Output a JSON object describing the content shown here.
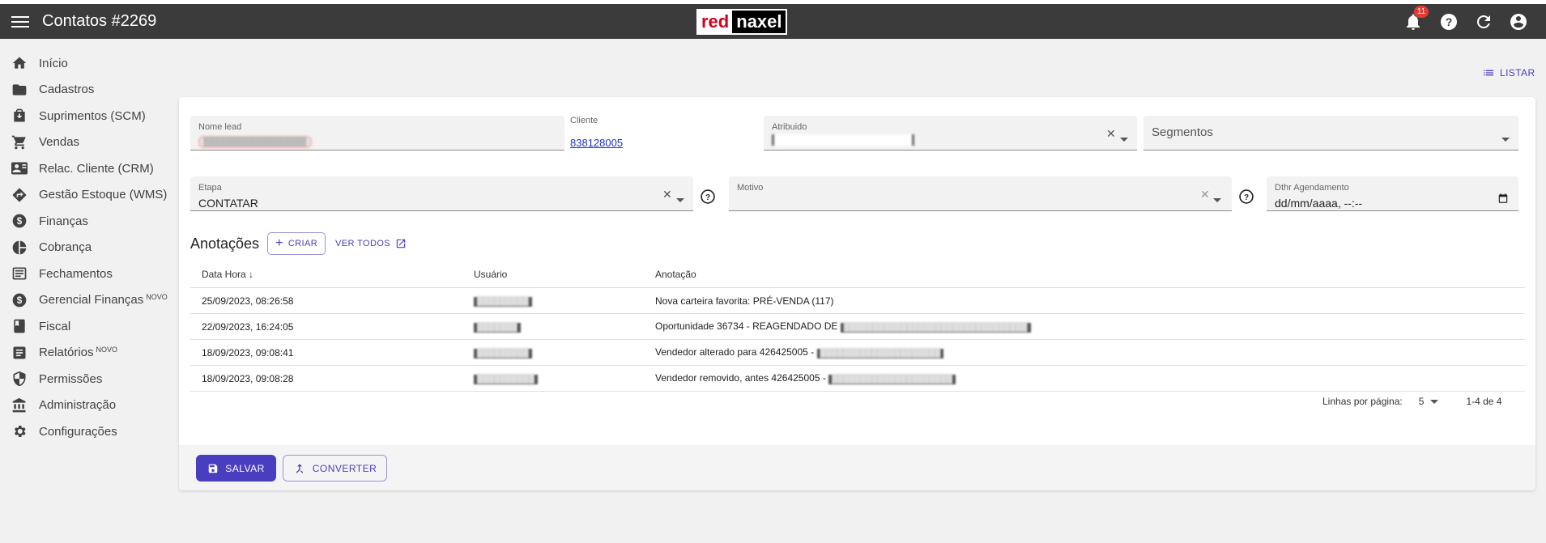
{
  "header": {
    "title": "Contatos #2269",
    "logo_red": "red",
    "logo_white": "naxel",
    "notification_count": "11"
  },
  "sidebar": {
    "items": [
      {
        "label": "Início",
        "icon": "home-icon"
      },
      {
        "label": "Cadastros",
        "icon": "folder-icon"
      },
      {
        "label": "Suprimentos (SCM)",
        "icon": "box-icon"
      },
      {
        "label": "Vendas",
        "icon": "cart-icon"
      },
      {
        "label": "Relac. Cliente (CRM)",
        "icon": "contact-card-icon"
      },
      {
        "label": "Gestão Estoque (WMS)",
        "icon": "warehouse-diamond-icon"
      },
      {
        "label": "Finanças",
        "icon": "dollar-circle-icon"
      },
      {
        "label": "Cobrança",
        "icon": "pie-chart-icon"
      },
      {
        "label": "Fechamentos",
        "icon": "list-box-icon"
      },
      {
        "label": "Gerencial Finanças",
        "badge": "NOVO",
        "icon": "dollar-circle-icon"
      },
      {
        "label": "Fiscal",
        "icon": "book-icon"
      },
      {
        "label": "Relatórios",
        "badge": "NOVO",
        "icon": "report-icon"
      },
      {
        "label": "Permissões",
        "icon": "shield-icon"
      },
      {
        "label": "Administração",
        "icon": "bank-icon"
      },
      {
        "label": "Configurações",
        "icon": "gear-icon"
      }
    ]
  },
  "toolbar": {
    "list_label": "LISTAR"
  },
  "form": {
    "nome_lead": {
      "label": "Nome lead",
      "value": "██████████████████"
    },
    "cliente": {
      "label": "Cliente",
      "value": "838128005"
    },
    "atribuido": {
      "label": "Atribuido",
      "value": "████████████████████"
    },
    "segmentos": {
      "placeholder": "Segmentos"
    },
    "etapa": {
      "label": "Etapa",
      "value": "CONTATAR"
    },
    "motivo": {
      "label": "Motivo",
      "value": ""
    },
    "dthr": {
      "label": "Dthr Agendamento",
      "value": "dd/mm/aaaa, --:--"
    }
  },
  "notes": {
    "title": "Anotações",
    "create_label": "CRIAR",
    "view_all_label": "VER TODOS",
    "columns": [
      "Data Hora",
      "Usuário",
      "Anotação"
    ],
    "rows": [
      {
        "date": "25/09/2023, 08:26:58",
        "user": "█████████",
        "note": "Nova carteira favorita: PRÉ-VENDA (117)",
        "note_hidden": ""
      },
      {
        "date": "22/09/2023, 16:24:05",
        "user": "███████",
        "note": "Oportunidade 36734 - REAGENDADO DE ",
        "note_hidden": "████████████████████████████████"
      },
      {
        "date": "18/09/2023, 09:08:41",
        "user": "█████████",
        "note": "Vendedor alterado para 426425005 - ",
        "note_hidden": "█████████████████████"
      },
      {
        "date": "18/09/2023, 09:08:28",
        "user": "██████████",
        "note": "Vendedor removido, antes 426425005 - ",
        "note_hidden": "█████████████████████"
      }
    ],
    "rows_per_page_label": "Linhas por página:",
    "rows_per_page": "5",
    "range": "1-4 de 4"
  },
  "actions": {
    "save_label": "SALVAR",
    "convert_label": "CONVERTER"
  }
}
